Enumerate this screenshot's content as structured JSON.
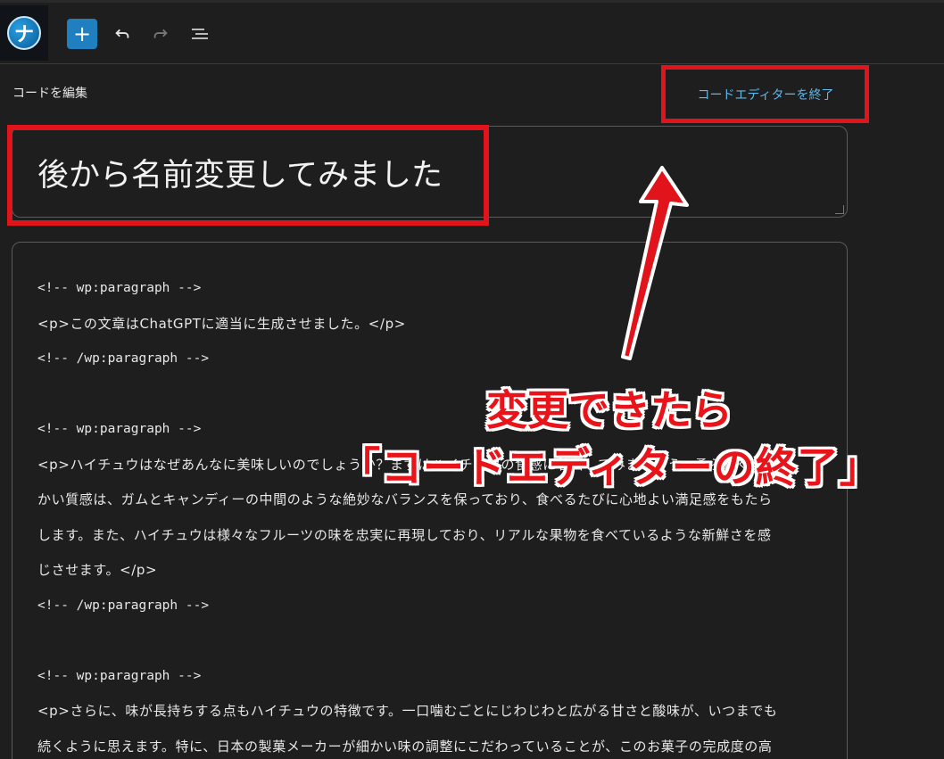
{
  "toolbar": {
    "logo_glyph": "ナ",
    "add_glyph": "+",
    "undo_icon": "undo-icon",
    "redo_icon": "redo-icon",
    "list_icon": "list-view-icon"
  },
  "editor": {
    "mode_label": "コードを編集",
    "exit_label": "コードエディターを終了",
    "title_value": "後から名前変更してみました"
  },
  "code_lines": [
    "<!-- wp:paragraph -->",
    "<p>この文章はChatGPTに適当に生成させました。</p>",
    "<!-- /wp:paragraph -->",
    "",
    "<!-- wp:paragraph -->",
    "<p>ハイチュウはなぜあんなに美味しいのでしょうか？まずはハイチュウの食感に着目してみましょう。柔らかく",
    "かい質感は、ガムとキャンディーの中間のような絶妙なバランスを保っており、食べるたびに心地よい満足感をもたら",
    "します。また、ハイチュウは様々なフルーツの味を忠実に再現しており、リアルな果物を食べているような新鮮さを感",
    "じさせます。</p>",
    "<!-- /wp:paragraph -->",
    "",
    "<!-- wp:paragraph -->",
    "<p>さらに、味が長持ちする点もハイチュウの特徴です。一口噛むごとにじわじわと広がる甘さと酸味が、いつまでも",
    "続くように思えます。特に、日本の製菓メーカーが細かい味の調整にこだわっていることが、このお菓子の完成度の高"
  ],
  "annotation": {
    "line1": "変更できたら",
    "line2": "「コードエディターの終了」"
  },
  "colors": {
    "background": "#1e1e1e",
    "accent": "#1f7fbf",
    "link": "#5fb8ea",
    "highlight_red": "#e0141a"
  }
}
